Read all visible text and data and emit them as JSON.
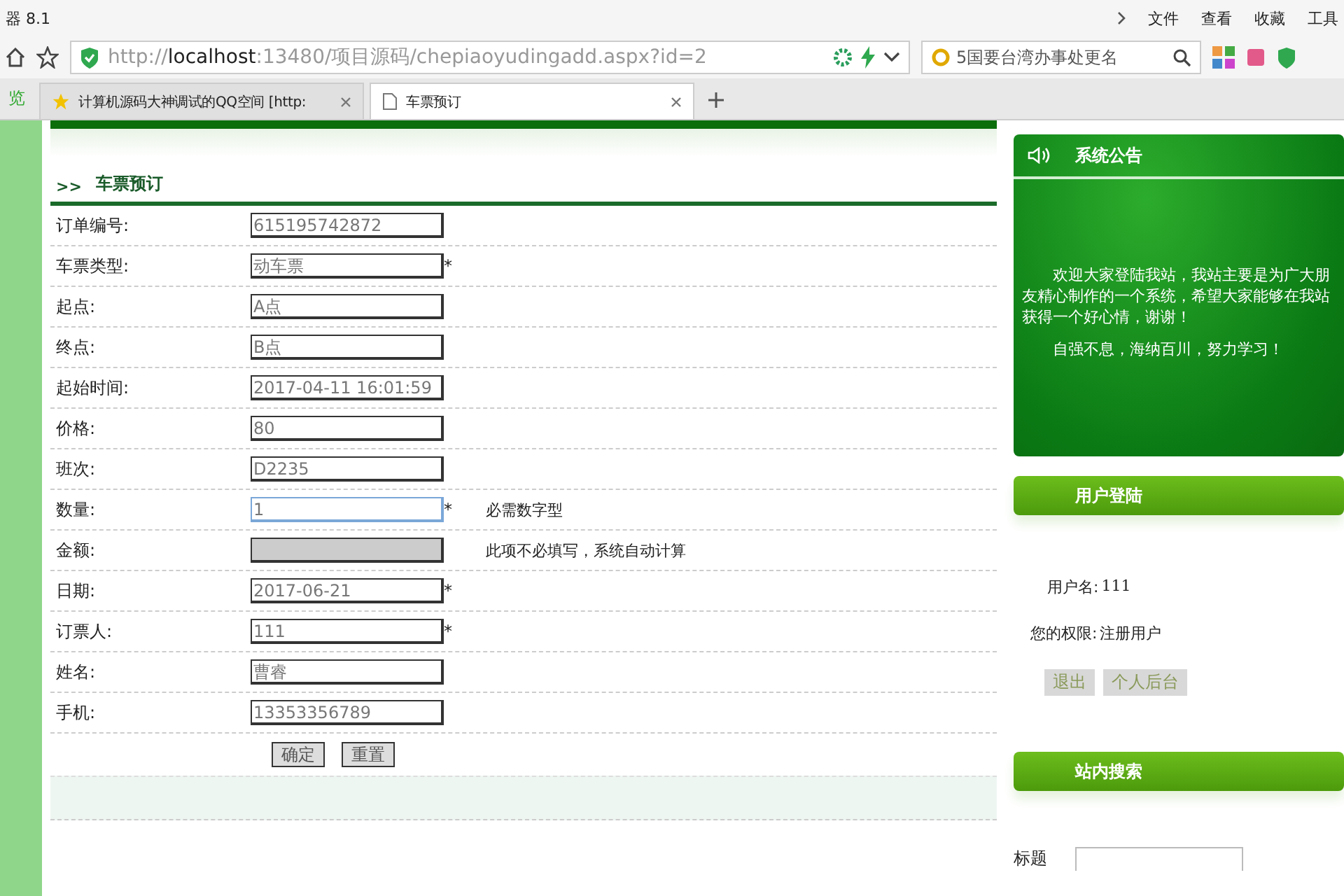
{
  "browser": {
    "title_fragment": "器 8.1",
    "menu": [
      "文件",
      "查看",
      "收藏",
      "工具"
    ],
    "address": {
      "scheme": "http://",
      "host": "localhost",
      "rest": ":13480/项目源码/chepiaoyudingadd.aspx?id=2"
    },
    "search": "5国要台湾办事处更名",
    "side_tab": "览",
    "tabs": [
      {
        "label": "计算机源码大神调试的QQ空间 [http:",
        "selected": false
      },
      {
        "label": "车票预订",
        "selected": true
      }
    ]
  },
  "form": {
    "title_mark": ">>",
    "title": "车票预订",
    "fields": [
      {
        "label": "订单编号:",
        "value": "615195742872",
        "disabled": false,
        "focused": false
      },
      {
        "label": "车票类型:",
        "value": "动车票",
        "mark": "*",
        "disabled": false,
        "focused": false
      },
      {
        "label": "起点:",
        "value": "A点",
        "disabled": false,
        "focused": false
      },
      {
        "label": "终点:",
        "value": "B点",
        "disabled": false,
        "focused": false
      },
      {
        "label": "起始时间:",
        "value": "2017-04-11 16:01:59",
        "disabled": false,
        "focused": false
      },
      {
        "label": "价格:",
        "value": "80",
        "disabled": false,
        "focused": false
      },
      {
        "label": "班次:",
        "value": "D2235",
        "disabled": false,
        "focused": false
      },
      {
        "label": "数量:",
        "value": "1",
        "mark": "*",
        "note": "必需数字型",
        "disabled": false,
        "focused": true
      },
      {
        "label": "金额:",
        "note": "此项不必填写，系统自动计算",
        "disabled": true,
        "focused": false
      },
      {
        "label": "日期:",
        "value": "2017-06-21",
        "mark": "*",
        "disabled": false,
        "focused": false
      },
      {
        "label": "订票人:",
        "value": "111",
        "mark": "*",
        "disabled": false,
        "focused": false
      },
      {
        "label": "姓名:",
        "value": "曹睿",
        "disabled": false,
        "focused": false
      },
      {
        "label": "手机:",
        "value": "13353356789",
        "disabled": false,
        "focused": false
      }
    ],
    "buttons": [
      "确定",
      "重置"
    ]
  },
  "sidebar": {
    "notice": {
      "title": "系统公告",
      "paragraphs": [
        "欢迎大家登陆我站，我站主要是为广大朋友精心制作的一个系统，希望大家能够在我站获得一个好心情，谢谢！",
        "自强不息，海纳百川，努力学习！"
      ]
    },
    "login": {
      "title": "用户登陆",
      "username_label": "用户名:",
      "username": "111",
      "role_label": "您的权限:",
      "role": "注册用户",
      "buttons": [
        "退出",
        "个人后台"
      ]
    },
    "search": {
      "title": "站内搜索",
      "label": "标题"
    }
  }
}
